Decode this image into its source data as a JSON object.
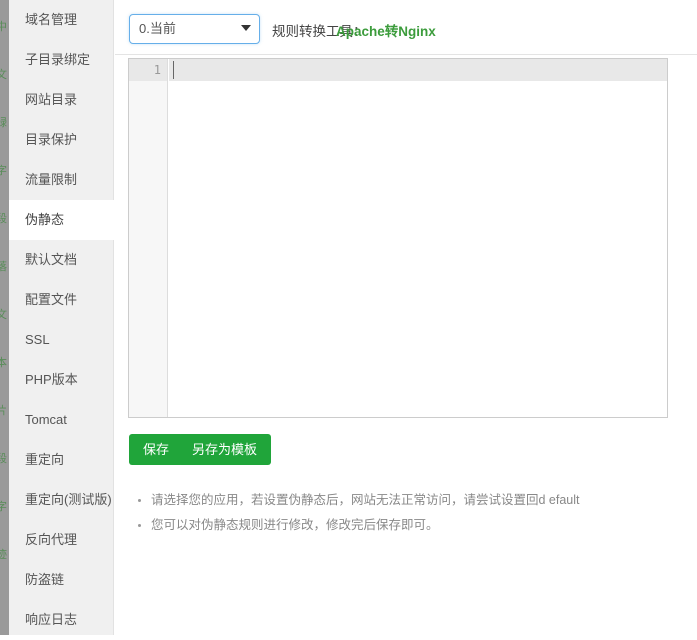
{
  "edge_strip": {
    "fragments": [
      "中",
      "文",
      "绿",
      "字",
      "段",
      "落",
      "文",
      "本",
      "片",
      "段",
      "字",
      "迹"
    ]
  },
  "sidebar": {
    "items": [
      {
        "label": "域名管理",
        "active": false
      },
      {
        "label": "子目录绑定",
        "active": false
      },
      {
        "label": "网站目录",
        "active": false
      },
      {
        "label": "目录保护",
        "active": false
      },
      {
        "label": "流量限制",
        "active": false
      },
      {
        "label": "伪静态",
        "active": true
      },
      {
        "label": "默认文档",
        "active": false
      },
      {
        "label": "配置文件",
        "active": false
      },
      {
        "label": "SSL",
        "active": false
      },
      {
        "label": "PHP版本",
        "active": false
      },
      {
        "label": "Tomcat",
        "active": false
      },
      {
        "label": "重定向",
        "active": false
      },
      {
        "label": "重定向(测试版)",
        "active": false
      },
      {
        "label": "反向代理",
        "active": false
      },
      {
        "label": "防盗链",
        "active": false
      },
      {
        "label": "响应日志",
        "active": false
      }
    ]
  },
  "toolbar": {
    "select": {
      "value": "0.当前",
      "options": [
        "0.当前"
      ]
    },
    "convert_label": "规则转换工具：",
    "convert_link": "Apache转Nginx",
    "link_color": "#3c9c3c"
  },
  "editor": {
    "line_numbers": [
      "1"
    ],
    "lines": [
      ""
    ],
    "content": ""
  },
  "buttons": {
    "save": "保存",
    "save_as_template": "另存为模板",
    "color": "#20a53a"
  },
  "help": {
    "items": [
      "请选择您的应用，若设置伪静态后，网站无法正常访问，请尝试设置回d efault",
      "您可以对伪静态规则进行修改，修改完后保存即可。"
    ]
  }
}
